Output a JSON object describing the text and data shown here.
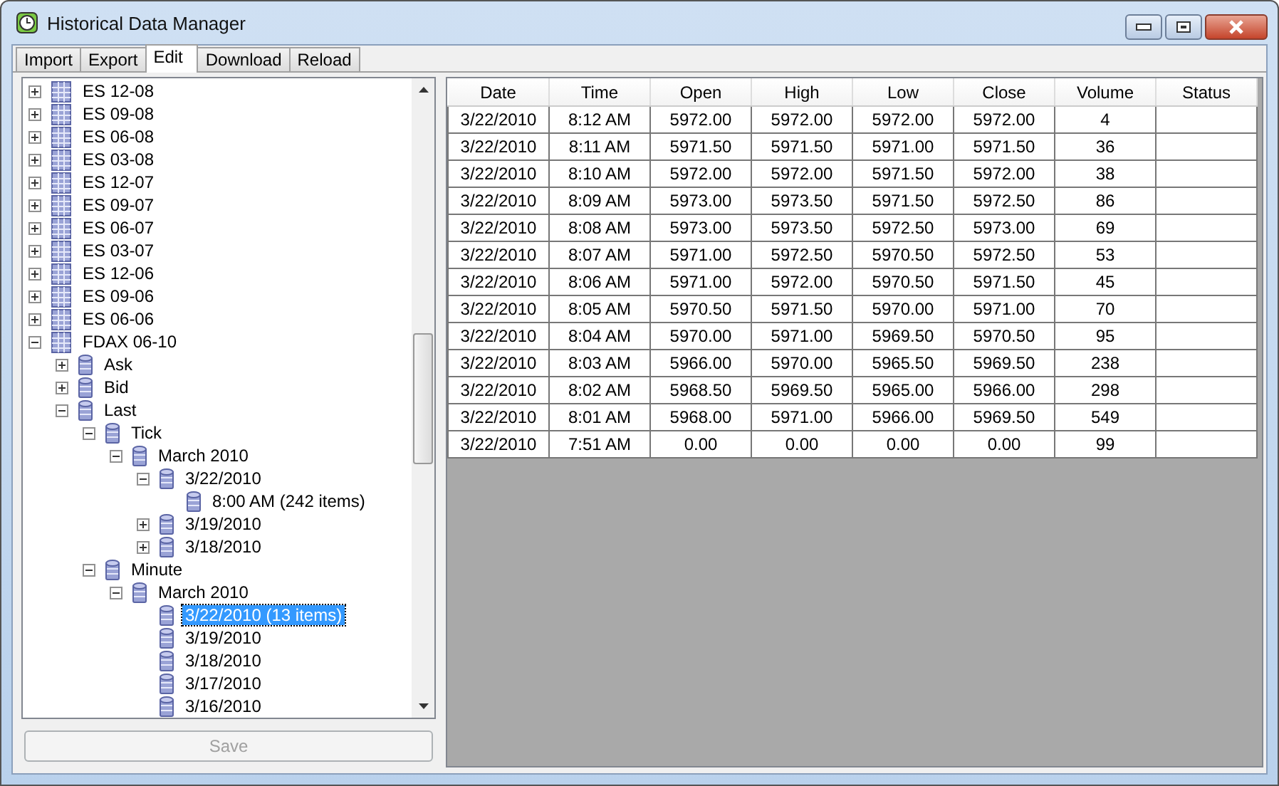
{
  "window": {
    "title": "Historical Data Manager"
  },
  "tabs": [
    {
      "label": "Import",
      "selected": false
    },
    {
      "label": "Export",
      "selected": false
    },
    {
      "label": "Edit",
      "selected": true
    },
    {
      "label": "Download",
      "selected": false
    },
    {
      "label": "Reload",
      "selected": false
    }
  ],
  "tree": [
    {
      "label": "ES 12-08",
      "expanded": false,
      "selected": false
    },
    {
      "label": "ES 09-08",
      "expanded": false,
      "selected": false
    },
    {
      "label": "ES 06-08",
      "expanded": false,
      "selected": false
    },
    {
      "label": "ES 03-08",
      "expanded": false,
      "selected": false
    },
    {
      "label": "ES 12-07",
      "expanded": false,
      "selected": false
    },
    {
      "label": "ES 09-07",
      "expanded": false,
      "selected": false
    },
    {
      "label": "ES 06-07",
      "expanded": false,
      "selected": false
    },
    {
      "label": "ES 03-07",
      "expanded": false,
      "selected": false
    },
    {
      "label": "ES 12-06",
      "expanded": false,
      "selected": false
    },
    {
      "label": "ES 09-06",
      "expanded": false,
      "selected": false
    },
    {
      "label": "ES 06-06",
      "expanded": false,
      "selected": false
    },
    {
      "label": "FDAX 06-10",
      "expanded": true,
      "selected": false,
      "children": [
        {
          "label": "Ask",
          "expanded": false,
          "selected": false
        },
        {
          "label": "Bid",
          "expanded": false,
          "selected": false
        },
        {
          "label": "Last",
          "expanded": true,
          "selected": false,
          "children": [
            {
              "label": "Tick",
              "expanded": true,
              "selected": false,
              "children": [
                {
                  "label": "March 2010",
                  "expanded": true,
                  "selected": false,
                  "children": [
                    {
                      "label": "3/22/2010",
                      "expanded": true,
                      "selected": false,
                      "children": [
                        {
                          "label": "8:00 AM (242 items)",
                          "selected": false
                        }
                      ]
                    },
                    {
                      "label": "3/19/2010",
                      "expanded": false,
                      "selected": false
                    },
                    {
                      "label": "3/18/2010",
                      "expanded": false,
                      "selected": false
                    }
                  ]
                }
              ]
            },
            {
              "label": "Minute",
              "expanded": true,
              "selected": false,
              "children": [
                {
                  "label": "March 2010",
                  "expanded": true,
                  "selected": false,
                  "children": [
                    {
                      "label": "3/22/2010 (13 items)",
                      "selected": true
                    },
                    {
                      "label": "3/19/2010",
                      "selected": false
                    },
                    {
                      "label": "3/18/2010",
                      "selected": false
                    },
                    {
                      "label": "3/17/2010",
                      "selected": false
                    },
                    {
                      "label": "3/16/2010",
                      "selected": false
                    }
                  ]
                }
              ]
            }
          ]
        }
      ]
    }
  ],
  "save_button": {
    "label": "Save",
    "disabled": true
  },
  "table": {
    "columns": [
      "Date",
      "Time",
      "Open",
      "High",
      "Low",
      "Close",
      "Volume",
      "Status"
    ],
    "rows": [
      [
        "3/22/2010",
        "8:12 AM",
        "5972.00",
        "5972.00",
        "5972.00",
        "5972.00",
        "4"
      ],
      [
        "3/22/2010",
        "8:11 AM",
        "5971.50",
        "5971.50",
        "5971.00",
        "5971.50",
        "36"
      ],
      [
        "3/22/2010",
        "8:10 AM",
        "5972.00",
        "5972.00",
        "5971.50",
        "5972.00",
        "38"
      ],
      [
        "3/22/2010",
        "8:09 AM",
        "5973.00",
        "5973.50",
        "5971.50",
        "5972.50",
        "86"
      ],
      [
        "3/22/2010",
        "8:08 AM",
        "5973.00",
        "5973.50",
        "5972.50",
        "5973.00",
        "69"
      ],
      [
        "3/22/2010",
        "8:07 AM",
        "5971.00",
        "5972.50",
        "5970.50",
        "5972.50",
        "53"
      ],
      [
        "3/22/2010",
        "8:06 AM",
        "5971.00",
        "5972.00",
        "5970.50",
        "5971.50",
        "45"
      ],
      [
        "3/22/2010",
        "8:05 AM",
        "5970.50",
        "5971.50",
        "5970.00",
        "5971.00",
        "70"
      ],
      [
        "3/22/2010",
        "8:04 AM",
        "5970.00",
        "5971.00",
        "5969.50",
        "5970.50",
        "95"
      ],
      [
        "3/22/2010",
        "8:03 AM",
        "5966.00",
        "5970.00",
        "5965.50",
        "5969.50",
        "238"
      ],
      [
        "3/22/2010",
        "8:02 AM",
        "5968.50",
        "5969.50",
        "5965.00",
        "5966.00",
        "298"
      ],
      [
        "3/22/2010",
        "8:01 AM",
        "5968.00",
        "5971.00",
        "5966.00",
        "5969.50",
        "549"
      ],
      [
        "3/22/2010",
        "7:51 AM",
        "0.00",
        "0.00",
        "0.00",
        "0.00",
        "99"
      ]
    ]
  }
}
